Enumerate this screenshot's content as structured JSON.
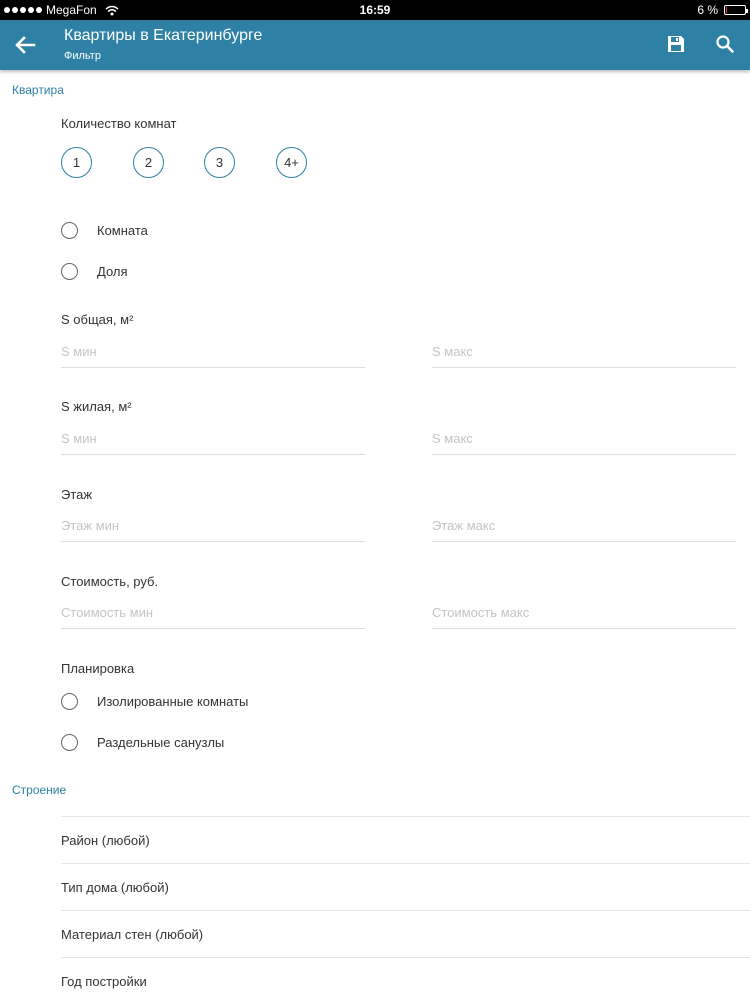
{
  "status_bar": {
    "carrier": "MegaFon",
    "time": "16:59",
    "battery": "6 %",
    "battery_level": 0.06
  },
  "app_bar": {
    "title": "Квартиры в Екатеринбурге",
    "subtitle": "Фильтр",
    "back_icon": "arrow-back-icon",
    "save_icon": "floppy-disk-icon",
    "search_icon": "search-icon"
  },
  "apartment": {
    "section_title": "Квартира",
    "rooms_label": "Количество комнат",
    "rooms": [
      "1",
      "2",
      "3",
      "4+"
    ],
    "type_options": [
      "Комната",
      "Доля"
    ],
    "ranges": [
      {
        "label": "S общая, м²",
        "min_placeholder": "S мин",
        "max_placeholder": "S макс"
      },
      {
        "label": "S жилая, м²",
        "min_placeholder": "S мин",
        "max_placeholder": "S макс"
      },
      {
        "label": "Этаж",
        "min_placeholder": "Этаж мин",
        "max_placeholder": "Этаж макс"
      },
      {
        "label": "Стоимость, руб.",
        "min_placeholder": "Стоимость мин",
        "max_placeholder": "Стоимость макс"
      }
    ],
    "layout_label": "Планировка",
    "layout_options": [
      "Изолированные комнаты",
      "Раздельные санузлы"
    ]
  },
  "building": {
    "section_title": "Строение",
    "items": [
      "Район (любой)",
      "Тип дома (любой)",
      "Материал стен (любой)",
      "Год постройки"
    ]
  },
  "colors": {
    "accent": "#2e80a4",
    "status_bar": "#000000"
  }
}
